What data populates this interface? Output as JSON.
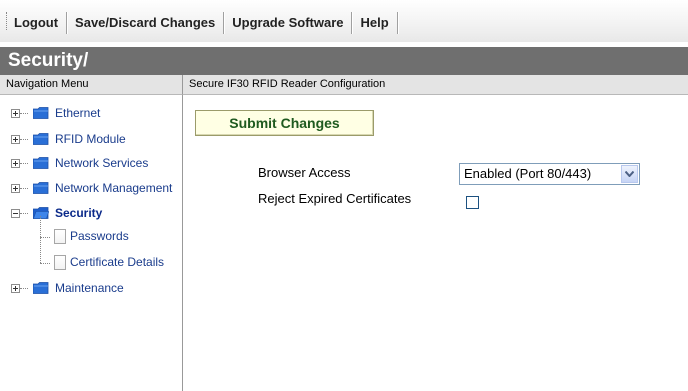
{
  "toolbar": {
    "buttons": [
      "Logout",
      "Save/Discard Changes",
      "Upgrade Software",
      "Help"
    ]
  },
  "header": {
    "title": "Security/"
  },
  "nav": {
    "header": "Navigation Menu",
    "items": [
      {
        "label": "Ethernet",
        "icon": "folder-icon",
        "expanded": false
      },
      {
        "label": "RFID Module",
        "icon": "folder-icon",
        "expanded": false
      },
      {
        "label": "Network Services",
        "icon": "folder-icon",
        "expanded": false
      },
      {
        "label": "Network Management",
        "icon": "folder-icon",
        "expanded": false
      },
      {
        "label": "Security",
        "icon": "folder-open-icon",
        "expanded": true,
        "children": [
          {
            "label": "Passwords"
          },
          {
            "label": "Certificate Details"
          }
        ]
      },
      {
        "label": "Maintenance",
        "icon": "folder-icon",
        "expanded": false
      }
    ]
  },
  "main": {
    "header": "Secure IF30 RFID Reader Configuration",
    "submit_label": "Submit Changes",
    "fields": {
      "browser_access_label": "Browser Access",
      "browser_access_value": "Enabled (Port 80/443)",
      "reject_expired_label": "Reject Expired Certificates",
      "reject_expired_checked": false
    }
  },
  "colors": {
    "header_bg": "#6f6f6f",
    "nav_link": "#1a3c8c",
    "folder": "#2a6fd6",
    "submit_bg": "#ffffe4",
    "submit_text": "#1f5a1f"
  }
}
